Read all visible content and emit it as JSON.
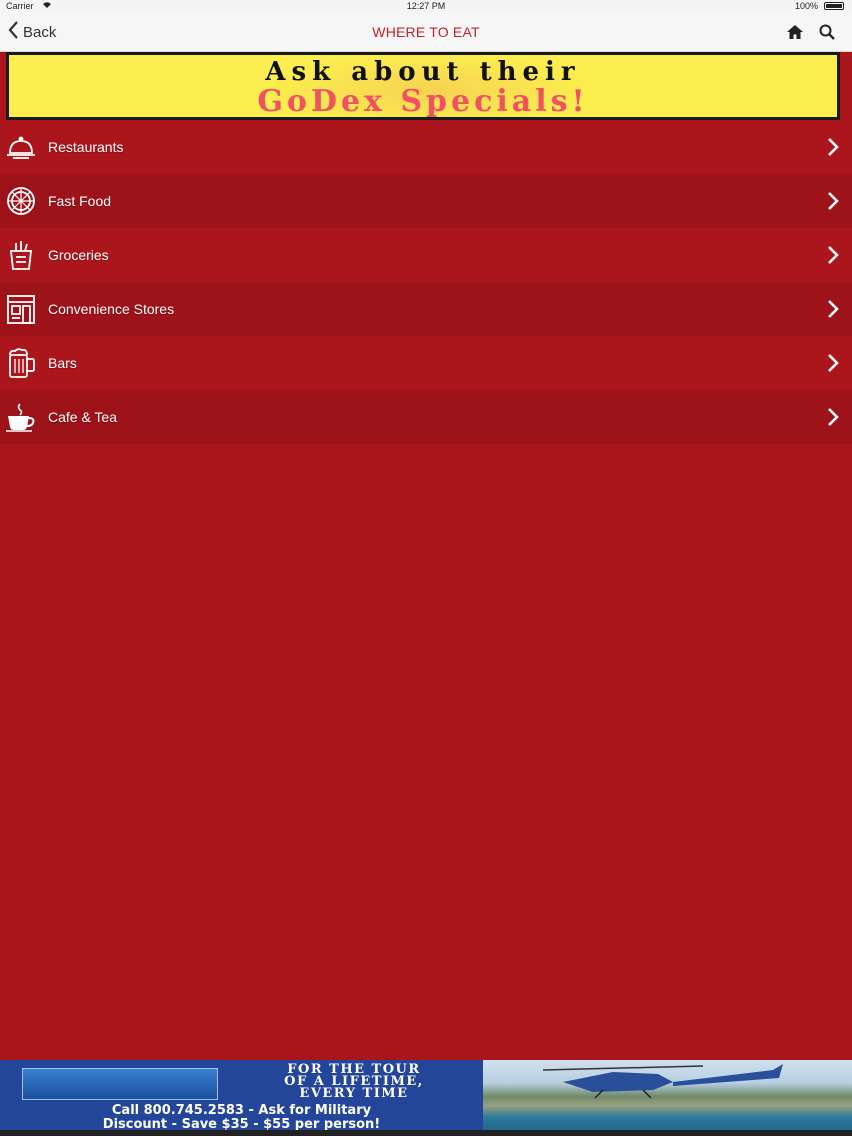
{
  "status_bar": {
    "carrier": "Carrier",
    "time": "12:27 PM",
    "battery": "100%"
  },
  "nav": {
    "back_label": "Back",
    "title": "WHERE TO EAT",
    "title_color": "#c8202a",
    "icons": [
      "home-icon",
      "search-icon"
    ]
  },
  "banner": {
    "line1": "Ask about their",
    "line2": "GoDex Specials!"
  },
  "menu": {
    "background": "#a8151a",
    "items": [
      {
        "label": "Restaurants",
        "icon": "cloche-icon"
      },
      {
        "label": "Fast Food",
        "icon": "pizza-icon"
      },
      {
        "label": "Groceries",
        "icon": "grocery-bag-icon"
      },
      {
        "label": "Convenience Stores",
        "icon": "store-icon"
      },
      {
        "label": "Bars",
        "icon": "beer-mug-icon"
      },
      {
        "label": "Cafe & Tea",
        "icon": "coffee-cup-icon"
      }
    ]
  },
  "bottom_ad": {
    "tagline_1": "FOR THE TOUR",
    "tagline_2": "OF A LIFETIME,",
    "tagline_3": "EVERY TIME",
    "phone_line": "Call 800.745.2583 - Ask for Military",
    "discount_line": "Discount - Save $35 - $55 per person!"
  }
}
